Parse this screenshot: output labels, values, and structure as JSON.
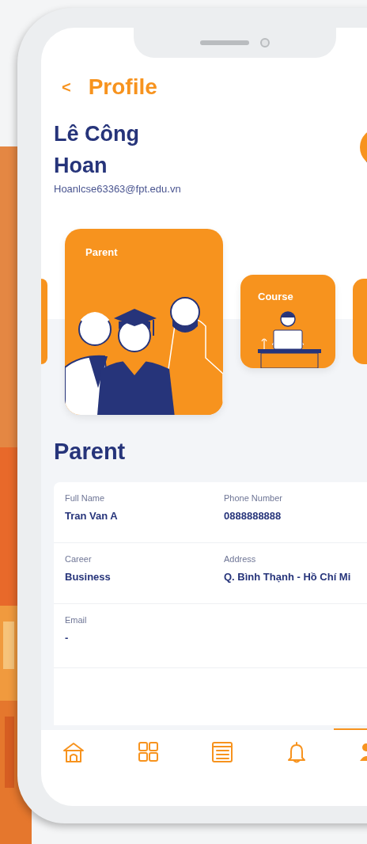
{
  "header": {
    "back": "<",
    "title": "Profile"
  },
  "user": {
    "name": "Lê Công Hoan",
    "email": "Hoanlcse63363@fpt.edu.vn"
  },
  "cards": [
    {
      "kind": "partial",
      "selected": false
    },
    {
      "kind": "parent",
      "label": "Parent",
      "selected": true
    },
    {
      "kind": "course",
      "label": "Course",
      "selected": false
    },
    {
      "kind": "partial",
      "selected": false
    }
  ],
  "section": {
    "title": "Parent"
  },
  "fields": [
    {
      "label": "Full Name",
      "value": "Tran Van A"
    },
    {
      "label": "Phone Number",
      "value": "0888888888"
    },
    {
      "label": "Career",
      "value": "Business"
    },
    {
      "label": "Address",
      "value": "Q. Bình Thạnh - Hồ Chí Mi"
    },
    {
      "label": "Email",
      "value": "-"
    }
  ],
  "nav": [
    {
      "kind": "home",
      "selected": false
    },
    {
      "kind": "grid",
      "selected": false
    },
    {
      "kind": "list",
      "selected": false
    },
    {
      "kind": "bell",
      "selected": false
    },
    {
      "kind": "people",
      "selected": true
    }
  ]
}
